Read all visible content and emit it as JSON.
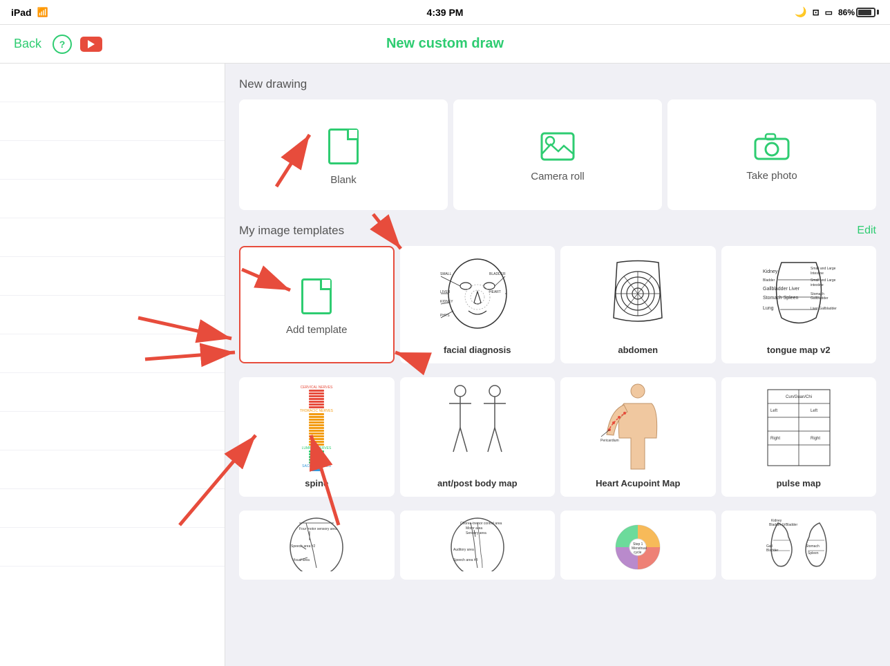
{
  "statusBar": {
    "device": "iPad",
    "wifi": "WiFi",
    "time": "4:39 PM",
    "moon": "🌙",
    "battery": "86%"
  },
  "navBar": {
    "backLabel": "Back",
    "title": "New custom draw"
  },
  "newDrawing": {
    "sectionTitle": "New drawing",
    "cards": [
      {
        "id": "blank",
        "label": "Blank",
        "icon": "doc"
      },
      {
        "id": "camera-roll",
        "label": "Camera roll",
        "icon": "img"
      },
      {
        "id": "take-photo",
        "label": "Take photo",
        "icon": "cam"
      }
    ]
  },
  "myTemplates": {
    "sectionTitle": "My image templates",
    "editLabel": "Edit",
    "templates": [
      {
        "id": "add-template",
        "label": "Add template",
        "type": "add"
      },
      {
        "id": "facial-diagnosis",
        "label": "facial diagnosis",
        "type": "image"
      },
      {
        "id": "abdomen",
        "label": "abdomen",
        "type": "image"
      },
      {
        "id": "tongue-map-v2",
        "label": "tongue map v2",
        "type": "image"
      },
      {
        "id": "spine",
        "label": "spine",
        "type": "image"
      },
      {
        "id": "ant-post-body-map",
        "label": "ant/post body map",
        "type": "image"
      },
      {
        "id": "heart-acupoint-map",
        "label": "Heart Acupoint Map",
        "type": "image"
      },
      {
        "id": "pulse-map",
        "label": "pulse map",
        "type": "image"
      },
      {
        "id": "brain-map-1",
        "label": "",
        "type": "image"
      },
      {
        "id": "brain-map-2",
        "label": "",
        "type": "image"
      },
      {
        "id": "menstrual-cycle",
        "label": "",
        "type": "image"
      },
      {
        "id": "bladder-map",
        "label": "",
        "type": "image"
      }
    ]
  },
  "sidebar": {
    "items": [
      "",
      "",
      "",
      "",
      "",
      "",
      "",
      "",
      "",
      "",
      "",
      "",
      ""
    ]
  }
}
